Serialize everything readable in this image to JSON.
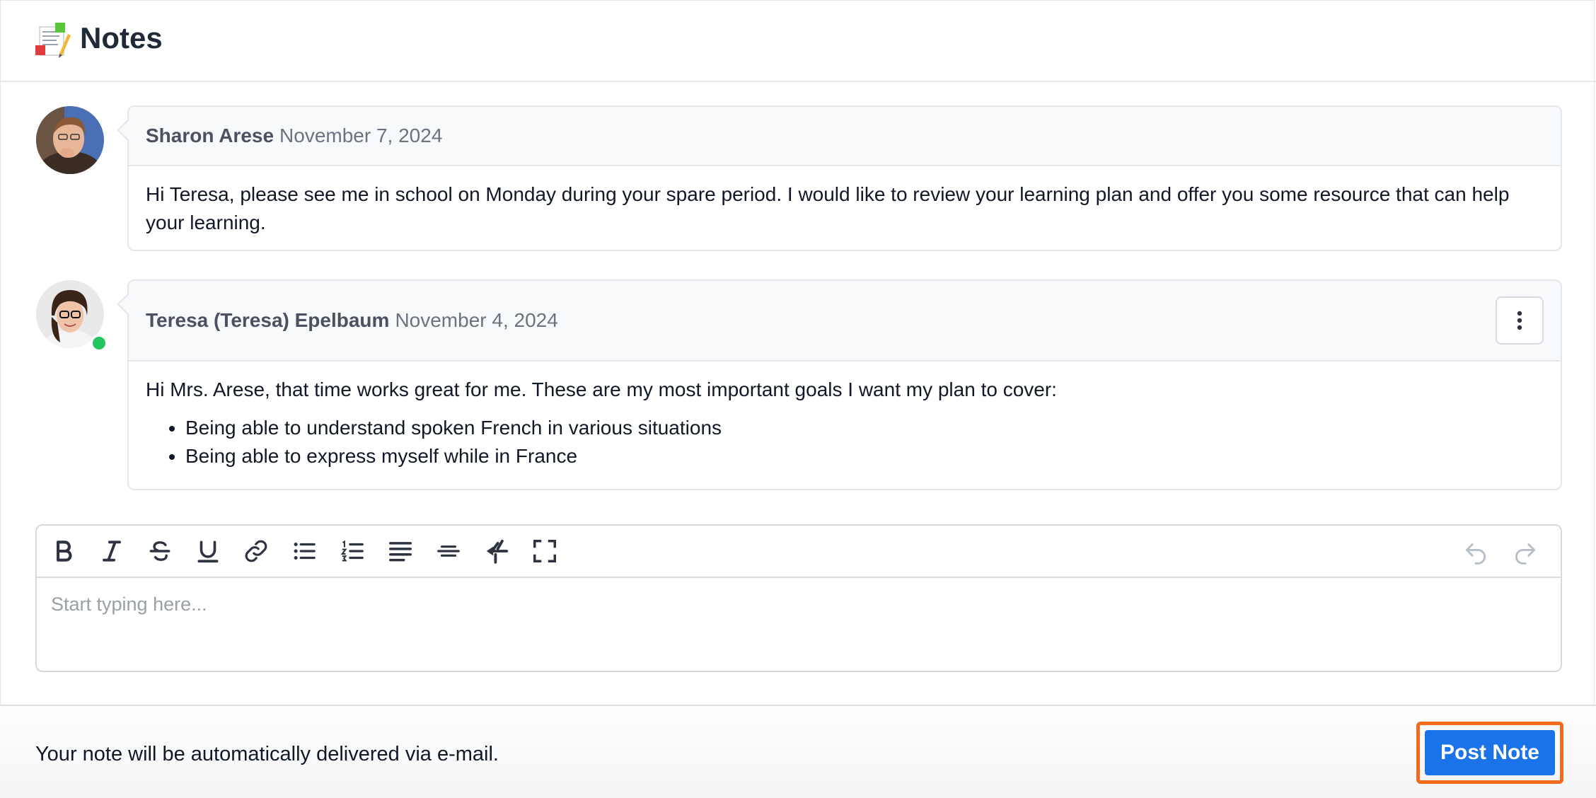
{
  "header": {
    "title": "Notes",
    "icon": "notes-icon"
  },
  "notes": [
    {
      "author": "Sharon Arese",
      "date": "November 7, 2024",
      "body": "Hi Teresa, please see me in school on Monday during your spare period. I would like to review your learning plan and offer you some resource that can help your learning."
    },
    {
      "author": "Teresa (Teresa) Epelbaum",
      "date": "November 4, 2024",
      "body": "Hi Mrs. Arese, that time works great for me. These are my most important goals I want my plan to cover:",
      "bullets": [
        "Being able to understand spoken French in various situations",
        "Being able to express myself while in France"
      ],
      "online": true
    }
  ],
  "editor": {
    "placeholder": "Start typing here...",
    "tools": [
      "bold-icon",
      "italic-icon",
      "strikethrough-icon",
      "underline-icon",
      "link-icon",
      "bullet-list-icon",
      "numbered-list-icon",
      "align-icon",
      "horizontal-rule-icon",
      "clear-format-icon",
      "fullscreen-icon"
    ],
    "history": [
      "undo-icon",
      "redo-icon"
    ]
  },
  "footer": {
    "message": "Your note will be automatically delivered via e-mail.",
    "post_label": "Post Note"
  },
  "colors": {
    "accent": "#1a73e8",
    "highlight": "#f26a1b",
    "online": "#22c55e"
  }
}
